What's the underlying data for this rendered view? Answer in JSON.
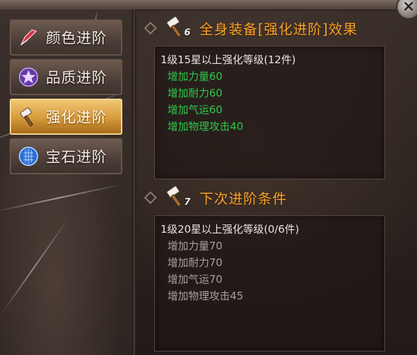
{
  "nav": {
    "items": [
      {
        "label": "颜色进阶",
        "icon": "blade-icon",
        "active": false
      },
      {
        "label": "品质进阶",
        "icon": "star-gem-icon",
        "active": false
      },
      {
        "label": "强化进阶",
        "icon": "hammer-icon",
        "active": true
      },
      {
        "label": "宝石进阶",
        "icon": "blue-gem-icon",
        "active": false
      }
    ]
  },
  "current_effect": {
    "badge_number": "6",
    "title": "全身装备[强化进阶]效果",
    "requirement": "1级15星以上强化等级(12件)",
    "bonuses": [
      "增加力量60",
      "增加耐力60",
      "增加气运60",
      "增加物理攻击40"
    ]
  },
  "next_condition": {
    "badge_number": "7",
    "title": "下次进阶条件",
    "requirement": "1级20星以上强化等级(0/6件)",
    "bonuses": [
      "增加力量70",
      "增加耐力70",
      "增加气运70",
      "增加物理攻击45"
    ]
  },
  "colors": {
    "title_orange": "#f6a12a",
    "active_bonus_green": "#2fc84a",
    "inactive_bonus_grey": "#a8a19b"
  },
  "close_label": "×"
}
